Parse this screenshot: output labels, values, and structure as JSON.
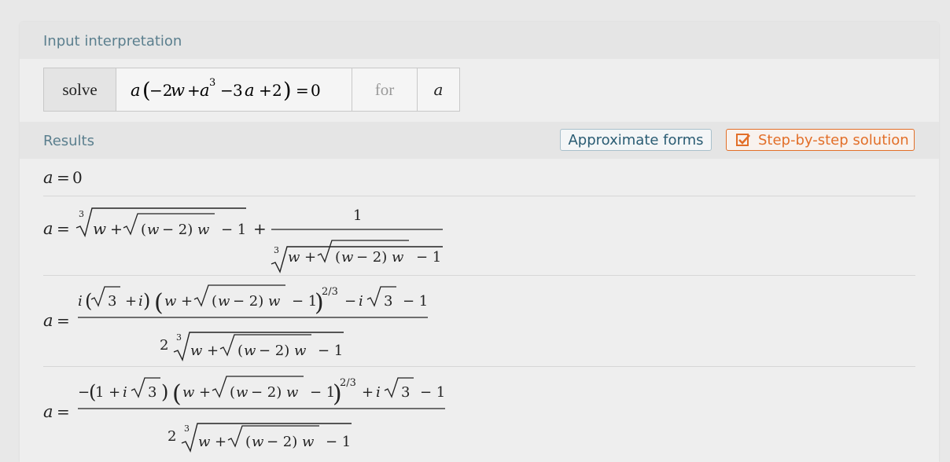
{
  "input_pod": {
    "title": "Input interpretation",
    "solve_label": "solve",
    "equation": "a (−2 w + a^3 − 3 a + 2) = 0",
    "for_label": "for",
    "variable": "a"
  },
  "results_pod": {
    "title": "Results",
    "approx_button": "Approximate forms",
    "step_button": "Step-by-step solution",
    "solutions": [
      "a = 0",
      "a = ∛(w + √((w − 2) w) − 1) + 1/∛(w + √((w − 2) w) − 1)",
      "a = (i (√3 + i) (w + √((w − 2) w) − 1)^(2/3) − i √3 − 1)/(2 ∛(w + √((w − 2) w) − 1))",
      "a = (−(1 + i √3) (w + √((w − 2) w) − 1)^(2/3) + i √3 − 1)/(2 ∛(w + √((w − 2) w) − 1))"
    ]
  },
  "colors": {
    "pod_title": "#5b7f8e",
    "step_accent": "#e26f29",
    "approx_text": "#2a5c73"
  }
}
